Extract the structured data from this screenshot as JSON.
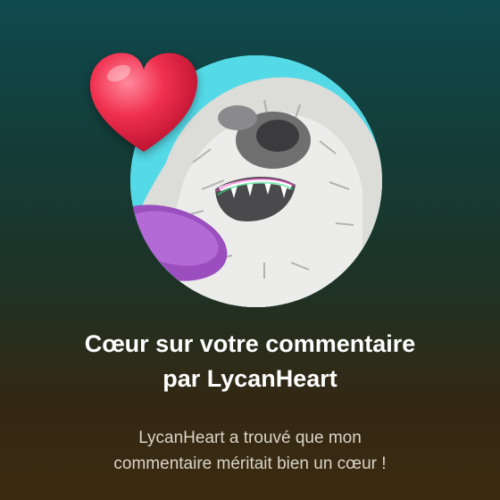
{
  "notification": {
    "title_line1": "Cœur sur votre commentaire",
    "title_line2": "par LycanHeart",
    "message_line1": "LycanHeart a trouvé que mon",
    "message_line2": "commentaire méritait bien un cœur !",
    "badge_icon": "heart-icon",
    "avatar_icon": "werewolf-avatar"
  },
  "colors": {
    "heart": "#f0304f",
    "avatar_bg": "#54d9e6",
    "background_top": "#0f4a4f",
    "background_bottom": "#3b2a10",
    "title_text": "#ffffff",
    "message_text": "#d9d4c8"
  }
}
